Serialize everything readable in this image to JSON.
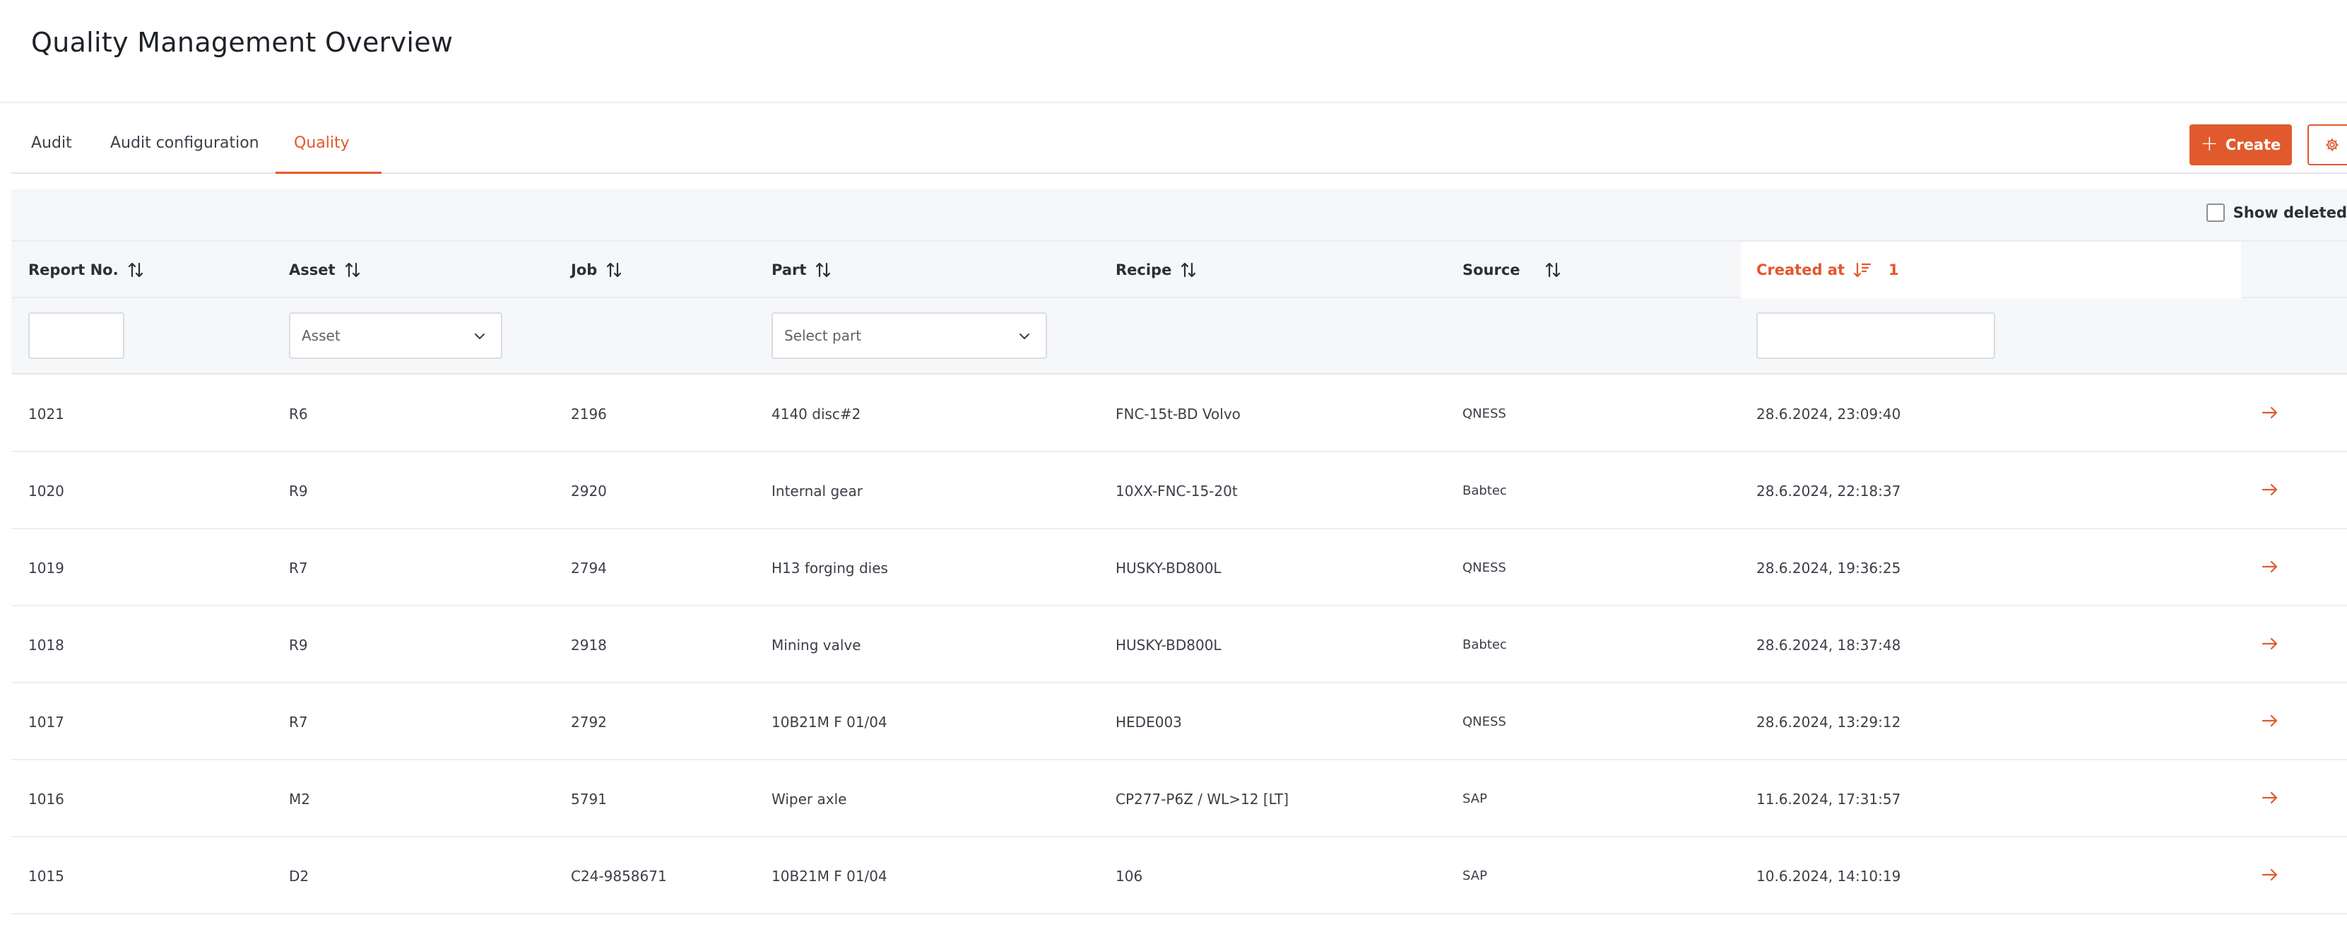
{
  "page": {
    "title": "Quality Management Overview"
  },
  "tabs": [
    {
      "label": "Audit"
    },
    {
      "label": "Audit configuration"
    },
    {
      "label": "Quality"
    }
  ],
  "actions": {
    "create_label": "Create",
    "settings_icon": "gear-icon"
  },
  "toolbar": {
    "show_deleted_label": "Show deleted",
    "show_deleted_checked": false
  },
  "table": {
    "columns": [
      {
        "label": "Report No."
      },
      {
        "label": "Asset"
      },
      {
        "label": "Job"
      },
      {
        "label": "Part"
      },
      {
        "label": "Recipe"
      },
      {
        "label": "Source"
      },
      {
        "label": "Created at",
        "sort_priority": "1"
      }
    ],
    "filters": {
      "report_no": "",
      "asset_placeholder": "Asset",
      "part_placeholder": "Select part",
      "created_at": ""
    },
    "rows": [
      {
        "report_no": "1021",
        "asset": "R6",
        "job": "2196",
        "part": "4140 disc#2",
        "recipe": "FNC-15t-BD Volvo",
        "source": "QNESS",
        "created_at": "28.6.2024, 23:09:40"
      },
      {
        "report_no": "1020",
        "asset": "R9",
        "job": "2920",
        "part": "Internal gear",
        "recipe": "10XX-FNC-15-20t",
        "source": "Babtec",
        "created_at": "28.6.2024, 22:18:37"
      },
      {
        "report_no": "1019",
        "asset": "R7",
        "job": "2794",
        "part": "H13 forging dies",
        "recipe": "HUSKY-BD800L",
        "source": "QNESS",
        "created_at": "28.6.2024, 19:36:25"
      },
      {
        "report_no": "1018",
        "asset": "R9",
        "job": "2918",
        "part": "Mining valve",
        "recipe": "HUSKY-BD800L",
        "source": "Babtec",
        "created_at": "28.6.2024, 18:37:48"
      },
      {
        "report_no": "1017",
        "asset": "R7",
        "job": "2792",
        "part": "10B21M F 01/04",
        "recipe": "HEDE003",
        "source": "QNESS",
        "created_at": "28.6.2024, 13:29:12"
      },
      {
        "report_no": "1016",
        "asset": "M2",
        "job": "5791",
        "part": "Wiper axle",
        "recipe": "CP277-P6Z / WL>12 [LT]",
        "source": "SAP",
        "created_at": "11.6.2024, 17:31:57"
      },
      {
        "report_no": "1015",
        "asset": "D2",
        "job": "C24-9858671",
        "part": "10B21M F 01/04",
        "recipe": "106",
        "source": "SAP",
        "created_at": "10.6.2024, 14:10:19"
      }
    ]
  },
  "colors": {
    "accent": "#e15a2d",
    "header_bg": "#f6f7f9",
    "border": "#e3e6ea"
  }
}
